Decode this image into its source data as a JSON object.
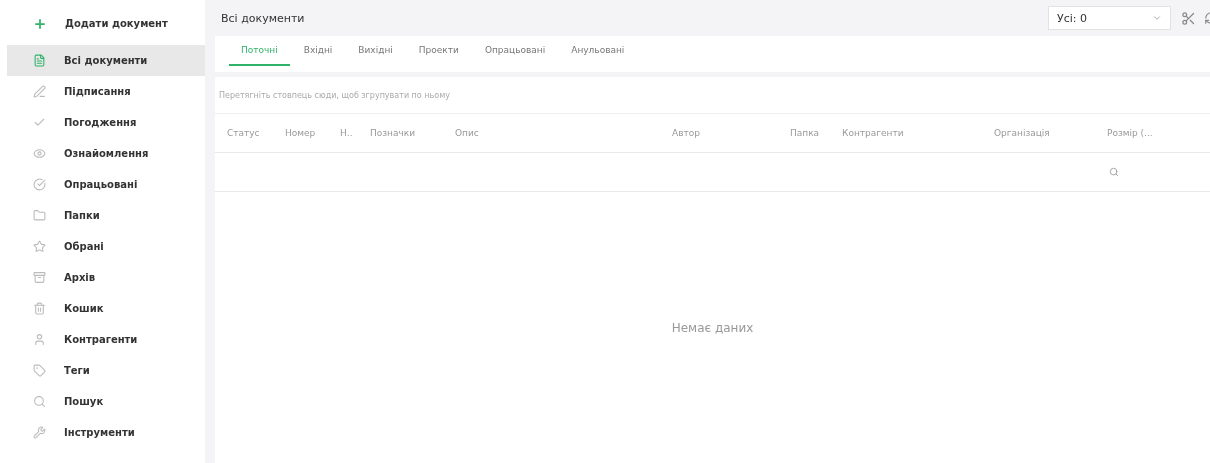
{
  "sidebar": {
    "add_button": "Додати документ",
    "items": [
      {
        "label": "Всі документи",
        "selected": true
      },
      {
        "label": "Підписання",
        "selected": false
      },
      {
        "label": "Погодження",
        "selected": false
      },
      {
        "label": "Ознайомлення",
        "selected": false
      },
      {
        "label": "Опрацьовані",
        "selected": false
      },
      {
        "label": "Папки",
        "selected": false
      },
      {
        "label": "Обрані",
        "selected": false
      },
      {
        "label": "Архів",
        "selected": false
      },
      {
        "label": "Кошик",
        "selected": false
      },
      {
        "label": "Контрагенти",
        "selected": false
      },
      {
        "label": "Теги",
        "selected": false
      },
      {
        "label": "Пошук",
        "selected": false
      },
      {
        "label": "Інструменти",
        "selected": false
      }
    ]
  },
  "header": {
    "title": "Всі документи",
    "filter_select": "Усі: 0"
  },
  "tabs": [
    {
      "label": "Поточні",
      "selected": true
    },
    {
      "label": "Вхідні",
      "selected": false
    },
    {
      "label": "Вихідні",
      "selected": false
    },
    {
      "label": "Проекти",
      "selected": false
    },
    {
      "label": "Опрацьовані",
      "selected": false
    },
    {
      "label": "Анульовані",
      "selected": false
    }
  ],
  "group_panel": "Перетягніть стовпець сюди, щоб згрупувати по ньому",
  "table": {
    "columns": [
      "Статус",
      "Номер",
      "Н..",
      "Позначки",
      "Опис",
      "Автор",
      "Папка",
      "Контрагенти",
      "Організація",
      "Розмір (..."
    ],
    "empty_text": "Немає даних"
  }
}
